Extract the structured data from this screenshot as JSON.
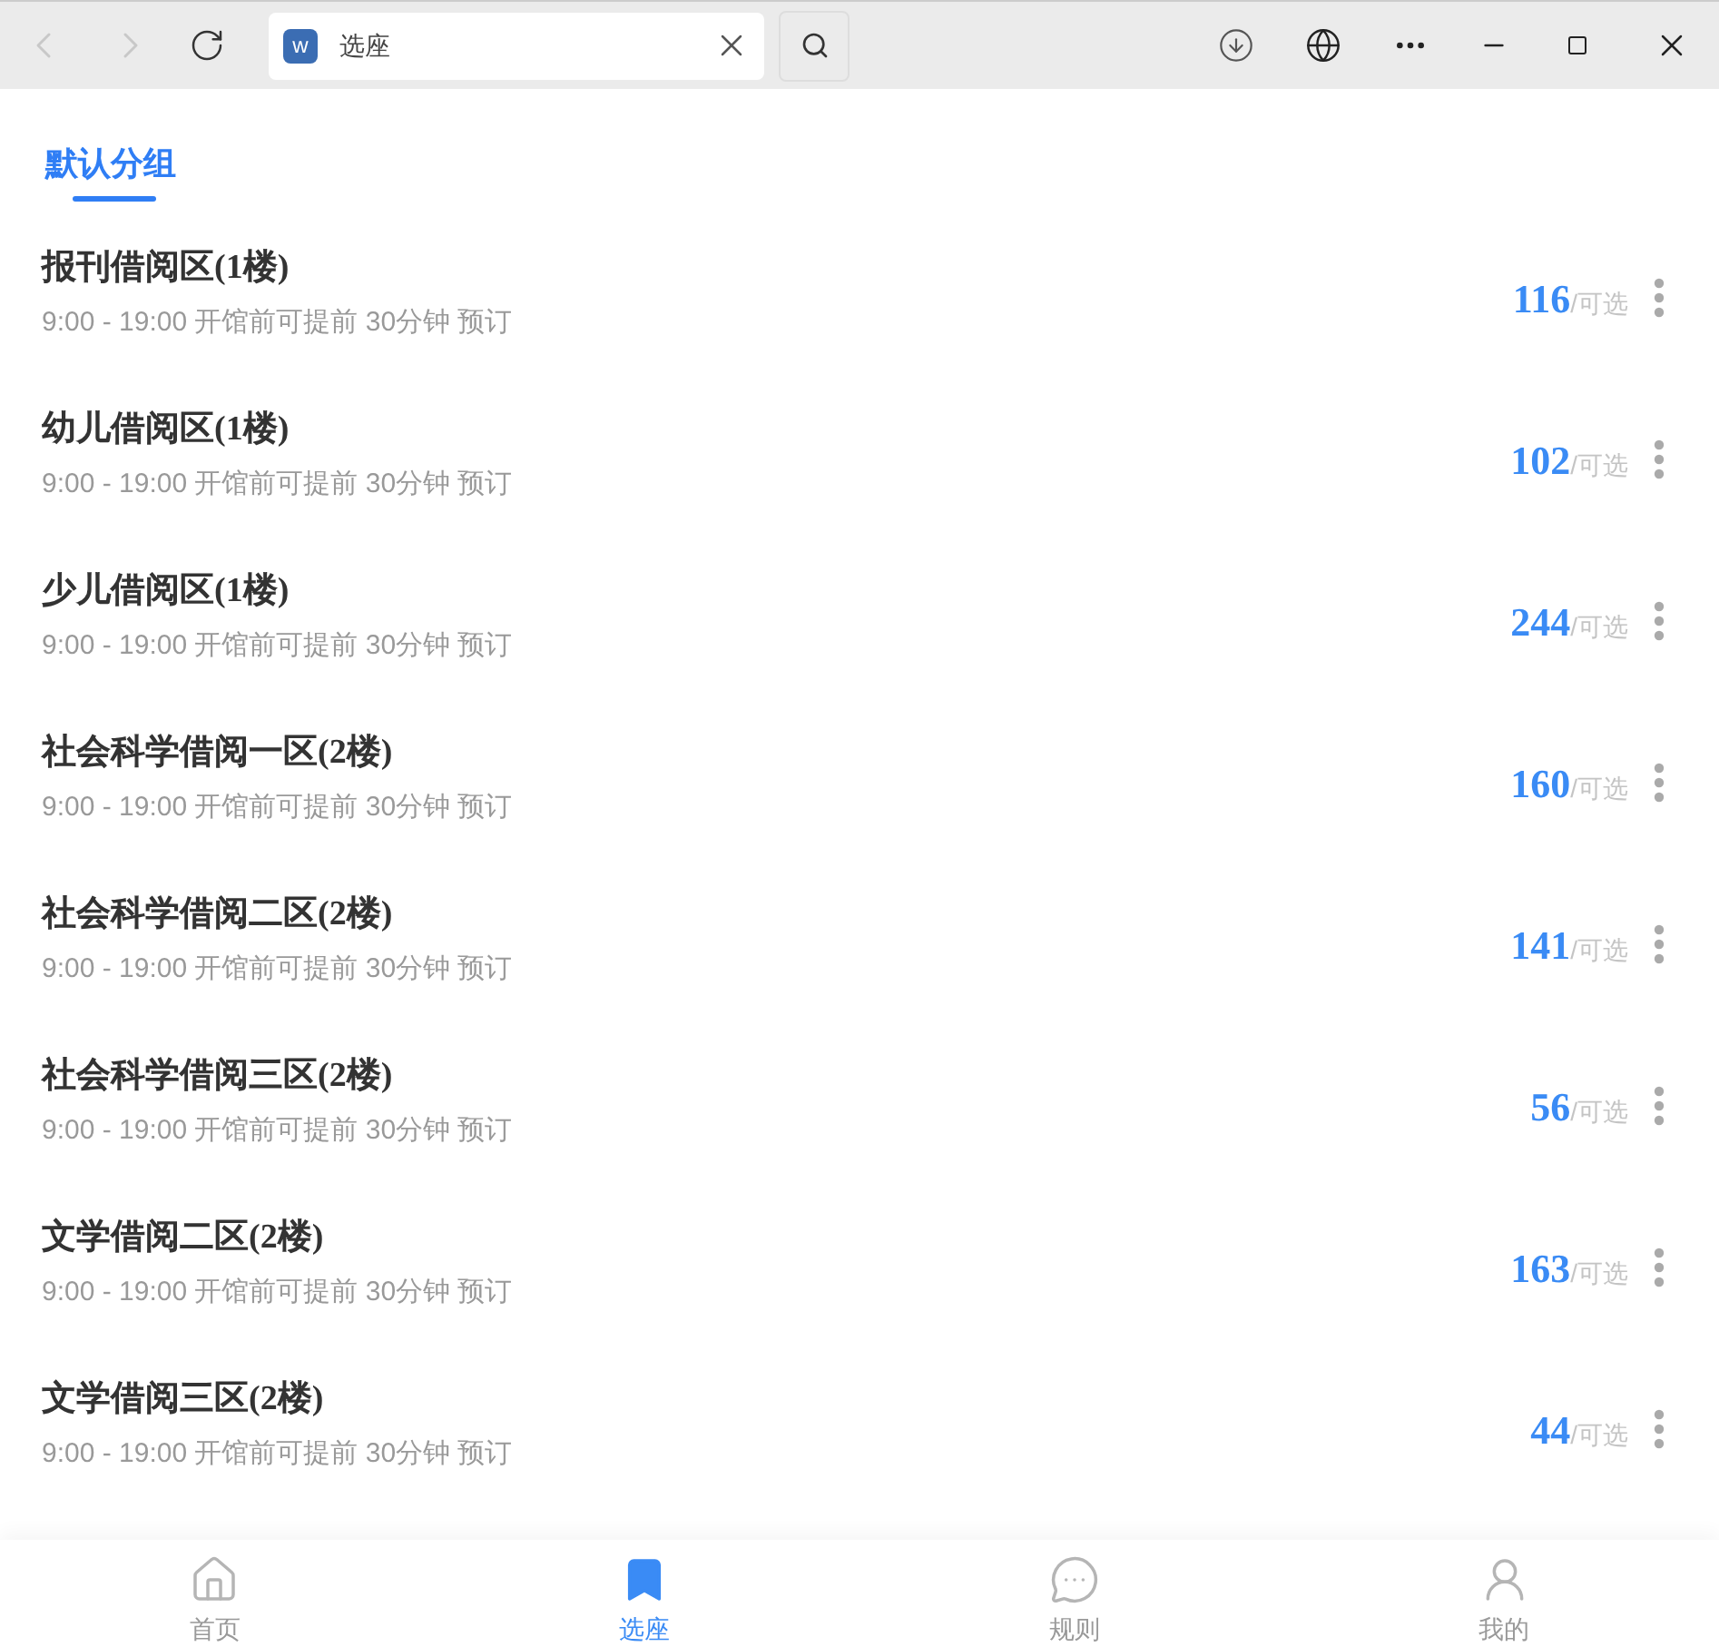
{
  "browser": {
    "site_logo": "w",
    "tab_title": "选座"
  },
  "tabs": [
    {
      "label": "默认分组",
      "selected": true
    }
  ],
  "rooms": [
    {
      "name": "报刊借阅区(1楼)",
      "hours": "9:00 - 19:00 开馆前可提前 30分钟 预订",
      "count": "116",
      "count_suffix": "/可选"
    },
    {
      "name": "幼儿借阅区(1楼)",
      "hours": "9:00 - 19:00 开馆前可提前 30分钟 预订",
      "count": "102",
      "count_suffix": "/可选"
    },
    {
      "name": "少儿借阅区(1楼)",
      "hours": "9:00 - 19:00 开馆前可提前 30分钟 预订",
      "count": "244",
      "count_suffix": "/可选"
    },
    {
      "name": "社会科学借阅一区(2楼)",
      "hours": "9:00 - 19:00 开馆前可提前 30分钟 预订",
      "count": "160",
      "count_suffix": "/可选"
    },
    {
      "name": "社会科学借阅二区(2楼)",
      "hours": "9:00 - 19:00 开馆前可提前 30分钟 预订",
      "count": "141",
      "count_suffix": "/可选"
    },
    {
      "name": "社会科学借阅三区(2楼)",
      "hours": "9:00 - 19:00 开馆前可提前 30分钟 预订",
      "count": "56",
      "count_suffix": "/可选"
    },
    {
      "name": "文学借阅二区(2楼)",
      "hours": "9:00 - 19:00 开馆前可提前 30分钟 预订",
      "count": "163",
      "count_suffix": "/可选"
    },
    {
      "name": "文学借阅三区(2楼)",
      "hours": "9:00 - 19:00 开馆前可提前 30分钟 预订",
      "count": "44",
      "count_suffix": "/可选"
    }
  ],
  "bottom_nav": [
    {
      "kind": "home",
      "label": "首页",
      "selected": false
    },
    {
      "kind": "seat",
      "label": "选座",
      "selected": true
    },
    {
      "kind": "rules",
      "label": "规则",
      "selected": false
    },
    {
      "kind": "me",
      "label": "我的",
      "selected": false
    }
  ]
}
